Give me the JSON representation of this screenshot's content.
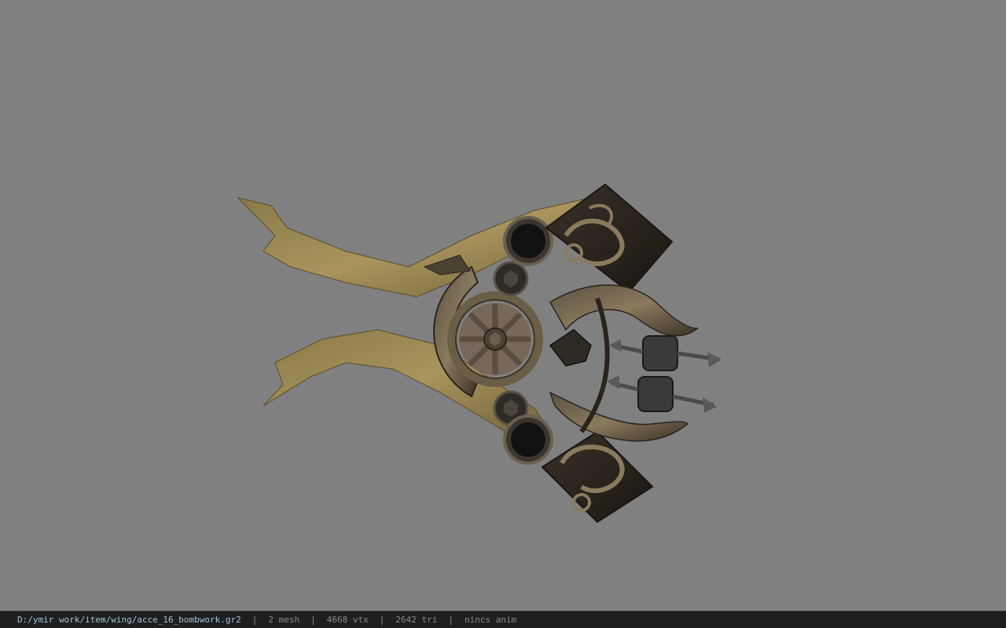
{
  "viewport": {
    "background": "#808080",
    "model_icon": "mechanical-wing-model"
  },
  "statusbar": {
    "file_path": "D:/ymir work/item/wing/acce_16_bombwork.gr2",
    "separator": "|",
    "mesh_count": "2 mesh",
    "vertex_count": "4668 vtx",
    "triangle_count": "2642 tri",
    "anim_status": "nincs anim",
    "path_color": "#9fc3d6",
    "text_color": "#8a8a8a"
  }
}
